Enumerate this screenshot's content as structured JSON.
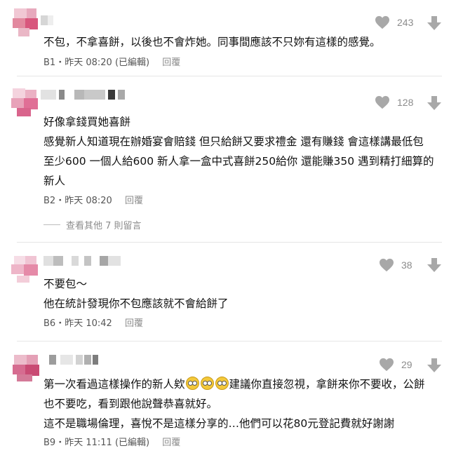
{
  "comments": [
    {
      "lines": [
        "不包，不拿喜餅，以後也不會炸她。同事間應該不只妳有這樣的感覺。"
      ],
      "floor": "B1",
      "time": "昨天 08:20",
      "edited": "(已編輯)",
      "reply": "回覆",
      "likes": "243",
      "colors": {
        "avatar_main": "#d8577d"
      }
    },
    {
      "lines": [
        "好像拿錢買她喜餅",
        "感覺新人知道現在辦婚宴會賠錢  但只給餅又要求禮金  還有賺錢  會這樣講最低包",
        "至少600  一個人給600  新人拿一盒中式喜餅250給你  還能賺350  遇到精打細算的",
        "新人"
      ],
      "floor": "B2",
      "time": "昨天 08:20",
      "reply": "回覆",
      "likes": "128",
      "more_replies": "查看其他 7 則留言",
      "colors": {
        "avatar_main": "#e06f96"
      }
    },
    {
      "lines": [
        "不要包～",
        "他在統計發現你不包應該就不會給餅了"
      ],
      "floor": "B6",
      "time": "昨天 10:42",
      "reply": "回覆",
      "likes": "38",
      "colors": {
        "avatar_main": "#e58aa8"
      }
    },
    {
      "line1_prefix": "第一次看過這樣操作的新人欸",
      "line1_suffix": "建議你直接忽視，拿餅來你不要收，公餅",
      "lines_after": [
        "也不要吃，看到跟他說聲恭喜就好。",
        "這不是職場倫理，喜悅不是這樣分享的…他們可以花80元登記費就好謝謝"
      ],
      "emoji": [
        "rolling-eyes-emoji",
        "rolling-eyes-emoji",
        "rolling-eyes-emoji"
      ],
      "floor": "B9",
      "time": "昨天 11:11",
      "edited": "(已編輯)",
      "reply": "回覆",
      "likes": "29",
      "colors": {
        "avatar_main": "#c94b74"
      }
    }
  ],
  "icons": {
    "like": "heart-icon",
    "dislike": "down-arrow-icon"
  },
  "colors": {
    "icon": "#9a9a9a",
    "divider": "#e6e6e6",
    "meta": "#555555",
    "muted": "#8c8c8c"
  }
}
